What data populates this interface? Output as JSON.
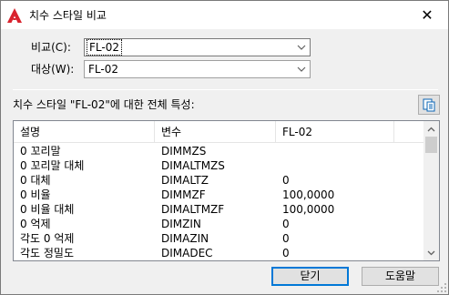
{
  "window": {
    "title": "치수 스타일 비교",
    "close_glyph": "✕"
  },
  "compare": {
    "label": "비교(C):",
    "value": "FL-02"
  },
  "target": {
    "label": "대상(W):",
    "value": "FL-02"
  },
  "properties_label": "치수 스타일 \"FL-02\"에 대한 전체 특성:",
  "table": {
    "columns": [
      "설명",
      "변수",
      "FL-02"
    ],
    "rows": [
      {
        "desc": "0 꼬리말",
        "var": "DIMMZS",
        "val": ""
      },
      {
        "desc": "0 꼬리말 대체",
        "var": "DIMALTMZS",
        "val": ""
      },
      {
        "desc": "0 대체",
        "var": "DIMALTZ",
        "val": "0"
      },
      {
        "desc": "0 비율",
        "var": "DIMMZF",
        "val": "100,0000"
      },
      {
        "desc": "0 비율 대체",
        "var": "DIMALTMZF",
        "val": "100,0000"
      },
      {
        "desc": "0 억제",
        "var": "DIMZIN",
        "val": "0"
      },
      {
        "desc": "각도 0 억제",
        "var": "DIMAZIN",
        "val": "0"
      },
      {
        "desc": "각도 정밀도",
        "var": "DIMADEC",
        "val": "0"
      }
    ]
  },
  "buttons": {
    "close": "닫기",
    "help": "도움말"
  },
  "icons": {
    "app": "autocad-a-icon",
    "copy": "copy-to-clipboard-icon",
    "dropdown": "chevron-down-icon"
  },
  "colors": {
    "accent": "#0078d7",
    "app_icon": "#d9232e"
  }
}
